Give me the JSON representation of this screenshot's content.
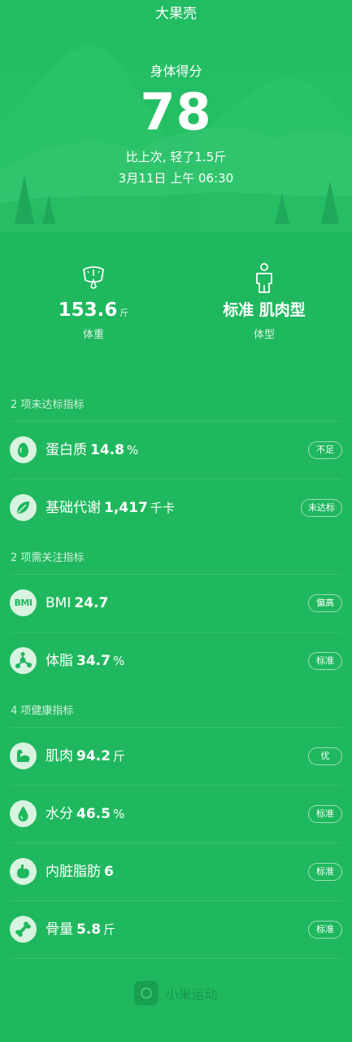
{
  "header": {
    "title": "大果壳"
  },
  "score": {
    "label": "身体得分",
    "value": "78",
    "compare": "比上次, 轻了1.5斤",
    "time": "3月11日 上午 06:30"
  },
  "summary": {
    "weight": {
      "value": "153.6",
      "unit": "斤",
      "caption": "体重",
      "icon": "scale-icon"
    },
    "body_type": {
      "value": "标准 肌肉型",
      "caption": "体型",
      "icon": "body-figure-icon"
    }
  },
  "sections": [
    {
      "title": "2 项未达标指标",
      "items": [
        {
          "name": "蛋白质",
          "value": "14.8",
          "unit": "%",
          "badge": "不足",
          "icon": "protein-egg-icon"
        },
        {
          "name": "基础代谢",
          "value": "1,417",
          "unit": "千卡",
          "badge": "未达标",
          "icon": "leaf-icon"
        }
      ]
    },
    {
      "title": "2 项需关注指标",
      "items": [
        {
          "name": "BMI",
          "value": "24.7",
          "unit": "",
          "badge": "偏高",
          "icon": "bmi-icon",
          "icon_text": "BMI"
        },
        {
          "name": "体脂",
          "value": "34.7",
          "unit": "%",
          "badge": "标准",
          "icon": "molecule-icon"
        }
      ]
    },
    {
      "title": "4 项健康指标",
      "items": [
        {
          "name": "肌肉",
          "value": "94.2",
          "unit": "斤",
          "badge": "优",
          "icon": "muscle-arm-icon"
        },
        {
          "name": "水分",
          "value": "46.5",
          "unit": "%",
          "badge": "标准",
          "icon": "water-drop-icon"
        },
        {
          "name": "内脏脂肪",
          "value": "6",
          "unit": "",
          "badge": "标准",
          "icon": "stomach-icon"
        },
        {
          "name": "骨量",
          "value": "5.8",
          "unit": "斤",
          "badge": "标准",
          "icon": "bone-icon"
        }
      ]
    }
  ],
  "footer": {
    "text": "小米运动",
    "icon": "mi-fit-logo-icon"
  },
  "colors": {
    "background": "#1fb85e",
    "icon_circle": "#d8f3e0",
    "text": "#ffffff"
  }
}
